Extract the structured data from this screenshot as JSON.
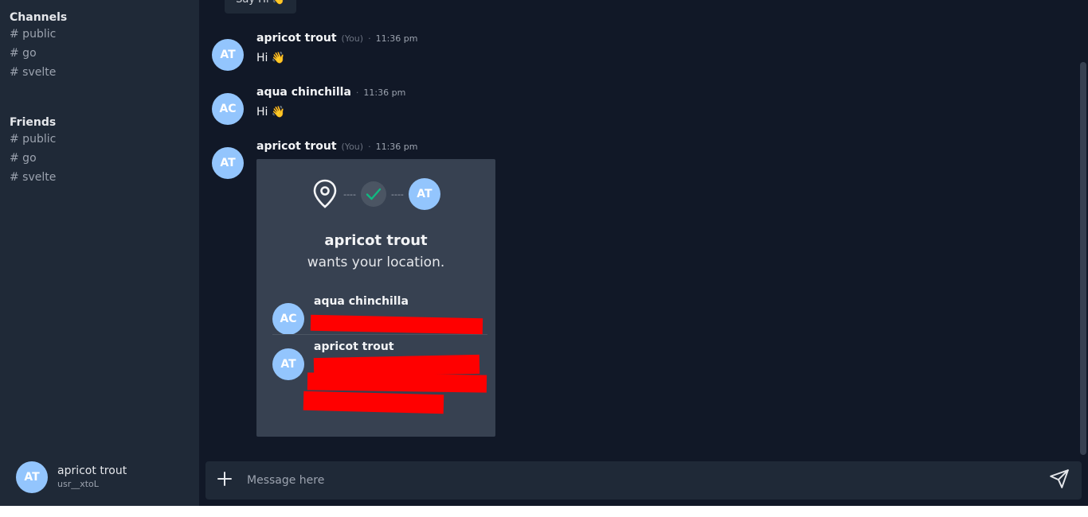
{
  "sidebar": {
    "channels_title": "Channels",
    "channels": [
      "# public",
      "# go",
      "# svelte"
    ],
    "friends_title": "Friends",
    "friends": [
      "# public",
      "# go",
      "# svelte"
    ],
    "user": {
      "initials": "AT",
      "name": "apricot trout",
      "id": "usr__xtoL"
    }
  },
  "feed": {
    "say_hi_label": "Say Hi 👋",
    "messages": [
      {
        "initials": "AT",
        "author": "apricot trout",
        "you": "(You)",
        "time": "11:36 pm",
        "text": "Hi 👋"
      },
      {
        "initials": "AC",
        "author": "aqua chinchilla",
        "you": "",
        "time": "11:36 pm",
        "text": "Hi 👋"
      },
      {
        "initials": "AT",
        "author": "apricot trout",
        "you": "(You)",
        "time": "11:36 pm",
        "text": ""
      }
    ],
    "location_card": {
      "dashes": "----",
      "requester_initials": "AT",
      "title": "apricot trout",
      "subtitle": "wants your location.",
      "members": [
        {
          "initials": "AC",
          "name": "aqua chinchilla"
        },
        {
          "initials": "AT",
          "name": "apricot trout"
        }
      ]
    }
  },
  "composer": {
    "placeholder": "Message here"
  },
  "colors": {
    "avatar": "#93c5fd",
    "sidebar": "#1f2937",
    "main": "#111827",
    "card": "#374151",
    "check": "#10b981",
    "redaction": "#ff0000"
  },
  "icons": [
    "location-pin-icon",
    "check-icon",
    "plus-icon",
    "send-icon"
  ]
}
